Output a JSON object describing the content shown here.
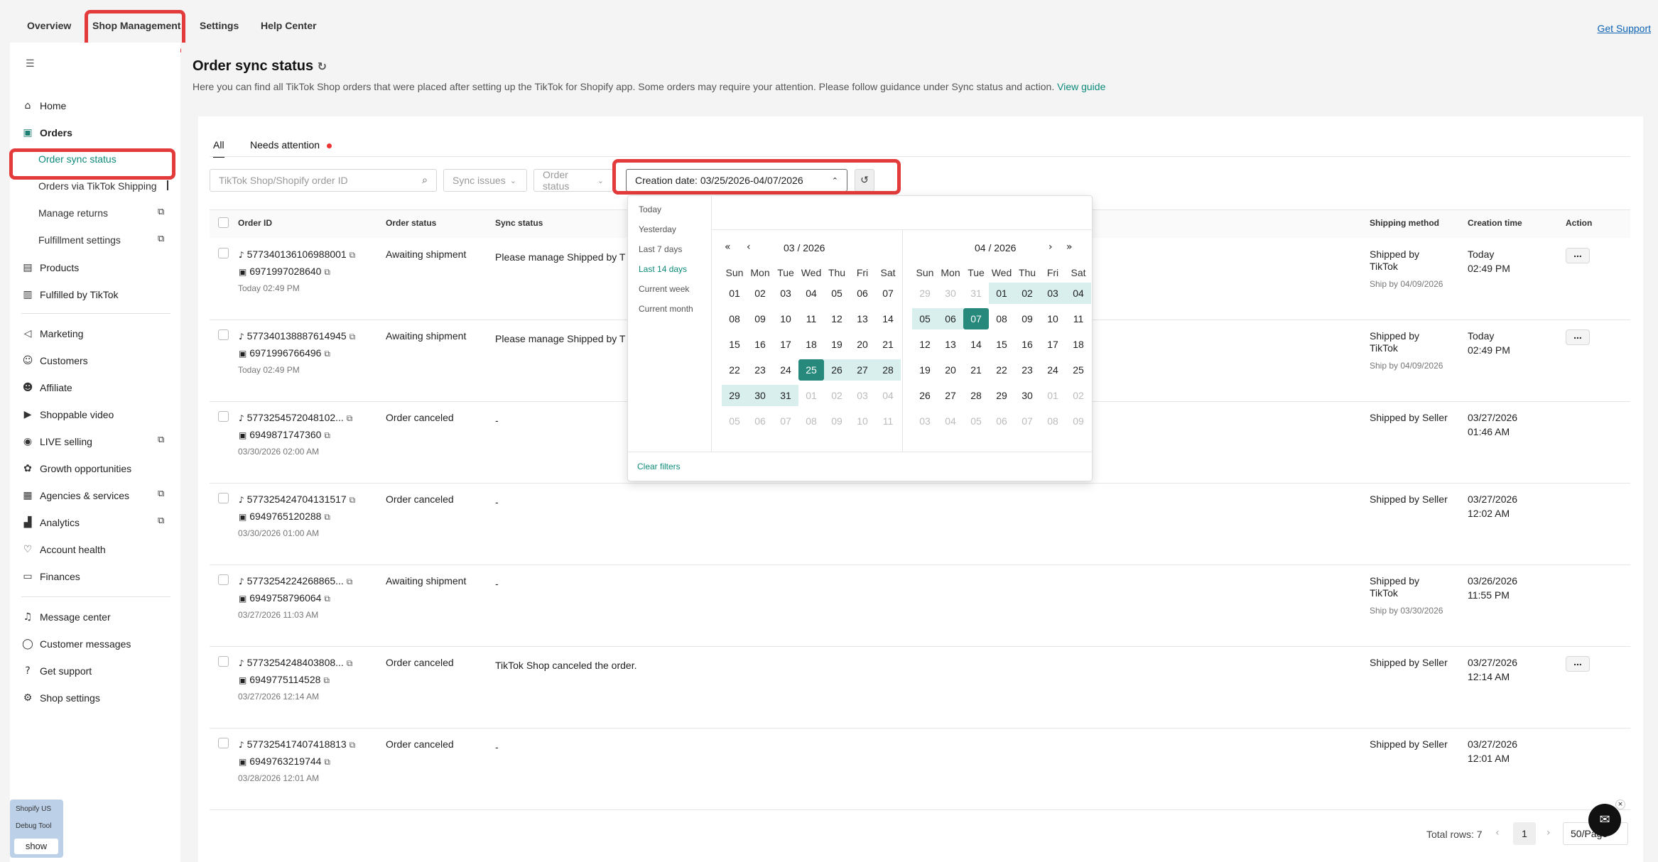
{
  "topnav": {
    "tabs": [
      "Overview",
      "Shop Management",
      "Settings",
      "Help Center"
    ],
    "support": "Get Support"
  },
  "sidebar": {
    "home": "Home",
    "orders": "Orders",
    "order_sync": "Order sync status",
    "via_tiktok": "Orders via TikTok Shipping",
    "manage_returns": "Manage returns",
    "fulfillment": "Fulfillment settings",
    "products": "Products",
    "fbt": "Fulfilled by TikTok",
    "marketing": "Marketing",
    "customers": "Customers",
    "affiliate": "Affiliate",
    "shoppable": "Shoppable video",
    "live": "LIVE selling",
    "growth": "Growth opportunities",
    "agencies": "Agencies & services",
    "analytics": "Analytics",
    "account_health": "Account health",
    "finances": "Finances",
    "message_center": "Message center",
    "customer_messages": "Customer messages",
    "get_support": "Get support",
    "shop_settings": "Shop settings"
  },
  "page": {
    "title": "Order sync status",
    "description": "Here you can find all TikTok Shop orders that were placed after setting up the TikTok for Shopify app. Some orders may require your attention. Please follow guidance under Sync status and action.",
    "guide": "View guide"
  },
  "tabs": {
    "all": "All",
    "needs": "Needs attention"
  },
  "filters": {
    "search_placeholder": "TikTok Shop/Shopify order ID",
    "sync": "Sync issues",
    "status": "Order status",
    "date": "Creation date: 03/25/2026-04/07/2026"
  },
  "columns": {
    "id": "Order ID",
    "status": "Order status",
    "sync": "Sync status",
    "shipping": "Shipping method",
    "created": "Creation time",
    "action": "Action"
  },
  "rows": [
    {
      "tt": "577340136106988001",
      "sp": "6971997028640",
      "time": "Today 02:49 PM",
      "status": "Awaiting shipment",
      "sync": "Please manage Shipped by T",
      "ship1": "Shipped by",
      "ship2": "TikTok",
      "shipby": "Ship by 04/09/2026",
      "c1": "Today",
      "c2": "02:49 PM",
      "action": "..."
    },
    {
      "tt": "577340138887614945",
      "sp": "6971996766496",
      "time": "Today 02:49 PM",
      "status": "Awaiting shipment",
      "sync": "Please manage Shipped by T",
      "ship1": "Shipped by",
      "ship2": "TikTok",
      "shipby": "Ship by 04/09/2026",
      "c1": "Today",
      "c2": "02:49 PM",
      "action": "..."
    },
    {
      "tt": "5773254572048102...",
      "sp": "6949871747360",
      "time": "03/30/2026 02:00 AM",
      "status": "Order canceled",
      "sync": "-",
      "ship1": "Shipped by Seller",
      "ship2": "",
      "shipby": "",
      "c1": "03/27/2026",
      "c2": "01:46 AM",
      "action": ""
    },
    {
      "tt": "577325424704131517",
      "sp": "6949765120288",
      "time": "03/30/2026 01:00 AM",
      "status": "Order canceled",
      "sync": "-",
      "ship1": "Shipped by Seller",
      "ship2": "",
      "shipby": "",
      "c1": "03/27/2026",
      "c2": "12:02 AM",
      "action": ""
    },
    {
      "tt": "5773254224268865...",
      "sp": "6949758796064",
      "time": "03/27/2026 11:03 AM",
      "status": "Awaiting shipment",
      "sync": "-",
      "ship1": "Shipped by",
      "ship2": "TikTok",
      "shipby": "Ship by 03/30/2026",
      "c1": "03/26/2026",
      "c2": "11:55 PM",
      "action": ""
    },
    {
      "tt": "5773254248403808...",
      "sp": "6949775114528",
      "time": "03/27/2026 12:14 AM",
      "status": "Order canceled",
      "sync": "TikTok Shop canceled the order.",
      "ship1": "Shipped by Seller",
      "ship2": "",
      "shipby": "",
      "c1": "03/27/2026",
      "c2": "12:14 AM",
      "action": "..."
    },
    {
      "tt": "577325417407418813",
      "sp": "6949763219744",
      "time": "03/28/2026 12:01 AM",
      "status": "Order canceled",
      "sync": "-",
      "ship1": "Shipped by Seller",
      "ship2": "",
      "shipby": "",
      "c1": "03/27/2026",
      "c2": "12:01 AM",
      "action": ""
    }
  ],
  "presets": [
    "Today",
    "Yesterday",
    "Last 7 days",
    "Last 14 days",
    "Current week",
    "Current month"
  ],
  "calendar": {
    "left_title": "03 / 2026",
    "right_title": "04 / 2026",
    "dow": [
      "Sun",
      "Mon",
      "Tue",
      "Wed",
      "Thu",
      "Fri",
      "Sat"
    ],
    "left": [
      [
        "01",
        "02",
        "03",
        "04",
        "05",
        "06",
        "07"
      ],
      [
        "08",
        "09",
        "10",
        "11",
        "12",
        "13",
        "14"
      ],
      [
        "15",
        "16",
        "17",
        "18",
        "19",
        "20",
        "21"
      ],
      [
        "22",
        "23",
        "24",
        "25",
        "26",
        "27",
        "28"
      ],
      [
        "29",
        "30",
        "31",
        "01",
        "02",
        "03",
        "04"
      ],
      [
        "05",
        "06",
        "07",
        "08",
        "09",
        "10",
        "11"
      ]
    ],
    "right": [
      [
        "29",
        "30",
        "31",
        "01",
        "02",
        "03",
        "04"
      ],
      [
        "05",
        "06",
        "07",
        "08",
        "09",
        "10",
        "11"
      ],
      [
        "12",
        "13",
        "14",
        "15",
        "16",
        "17",
        "18"
      ],
      [
        "19",
        "20",
        "21",
        "22",
        "23",
        "24",
        "25"
      ],
      [
        "26",
        "27",
        "28",
        "29",
        "30",
        "01",
        "02"
      ],
      [
        "03",
        "04",
        "05",
        "06",
        "07",
        "08",
        "09"
      ]
    ],
    "clear": "Clear filters"
  },
  "pager": {
    "total": "Total rows: 7",
    "page": "1",
    "size": "50/Page"
  },
  "debug": {
    "l1": "Shopify US",
    "l2": "Debug Tool",
    "btn": "show"
  }
}
